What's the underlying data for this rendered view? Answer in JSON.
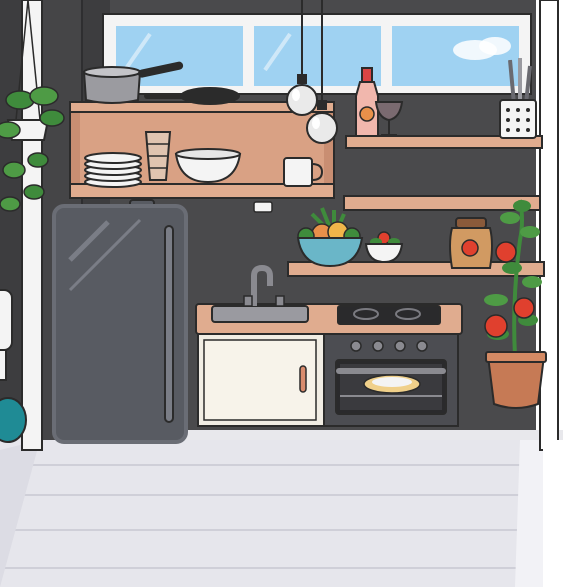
{
  "scene": {
    "name": "kitchen room",
    "colors": {
      "wall": "#4a4a4c",
      "wall_left": "#3d3d3f",
      "floor": "#e6e6ec",
      "floor_line": "#cfcfd8",
      "wood": "#e0ac8f",
      "wood_dark": "#c98e72",
      "sky": "#9fd2f2",
      "window_frame": "#f4f4f4",
      "fridge": "#585b62",
      "cabinet": "#f1ede4",
      "oven": "#4c4d52",
      "stovetop": "#2a2a2c",
      "terracotta": "#c67a55",
      "tomato": "#e0402e",
      "leaf": "#3f8b3c",
      "outline": "#2b2b2b"
    },
    "items": [
      {
        "key": "window",
        "icon": "window-icon"
      },
      {
        "key": "pendant_lamp_left",
        "icon": "pendant-lamp-icon"
      },
      {
        "key": "pendant_lamp_right",
        "icon": "pendant-lamp-icon"
      },
      {
        "key": "hanging_plant",
        "icon": "hanging-plant-icon"
      },
      {
        "key": "wall_shelf_cabinet",
        "icon": "shelf-icon"
      },
      {
        "key": "saucepan",
        "icon": "saucepan-icon"
      },
      {
        "key": "frying_pan",
        "icon": "frying-pan-icon"
      },
      {
        "key": "plate_stack",
        "icon": "plates-icon"
      },
      {
        "key": "glass_stack",
        "icon": "glasses-icon"
      },
      {
        "key": "mixing_bowl",
        "icon": "bowl-icon"
      },
      {
        "key": "mug",
        "icon": "mug-icon"
      },
      {
        "key": "sauce_bottle",
        "icon": "bottle-icon"
      },
      {
        "key": "wine_glass",
        "icon": "wine-glass-icon"
      },
      {
        "key": "utensil_holder",
        "icon": "utensil-holder-icon"
      },
      {
        "key": "fridge",
        "icon": "fridge-icon"
      },
      {
        "key": "fruit_bowl",
        "icon": "fruit-bowl-icon"
      },
      {
        "key": "salad_bowl",
        "icon": "salad-bowl-icon"
      },
      {
        "key": "tomato_jar",
        "icon": "jar-icon"
      },
      {
        "key": "sink",
        "icon": "sink-icon"
      },
      {
        "key": "faucet",
        "icon": "faucet-icon"
      },
      {
        "key": "stovetop",
        "icon": "stovetop-icon"
      },
      {
        "key": "cabinet_door",
        "icon": "cabinet-icon"
      },
      {
        "key": "oven",
        "icon": "oven-icon"
      },
      {
        "key": "pizza",
        "icon": "pizza-icon"
      },
      {
        "key": "tomato_plant",
        "icon": "tomato-plant-icon"
      },
      {
        "key": "toilet_edge",
        "icon": "toilet-icon"
      }
    ]
  }
}
